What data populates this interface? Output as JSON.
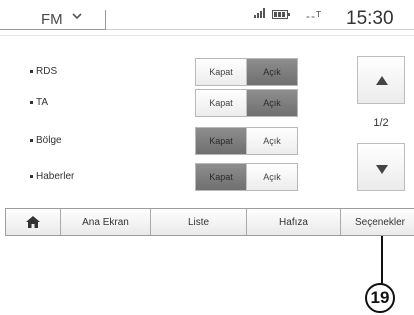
{
  "status_bar": {
    "source": "FM",
    "bt_indicator": "--ᵀ",
    "clock": "15:30",
    "icons": [
      "chevron-down-icon",
      "signal-icon",
      "battery-icon"
    ]
  },
  "settings": [
    {
      "label": "RDS",
      "off_label": "Kapat",
      "on_label": "Açık",
      "state": "on"
    },
    {
      "label": "TA",
      "off_label": "Kapat",
      "on_label": "Açık",
      "state": "on"
    },
    {
      "label": "Bölge",
      "off_label": "Kapat",
      "on_label": "Açık",
      "state": "off"
    },
    {
      "label": "Haberler",
      "off_label": "Kapat",
      "on_label": "Açık",
      "state": "off"
    }
  ],
  "scroll": {
    "page_indicator": "1/2",
    "up_icon": "arrow-up-icon",
    "down_icon": "arrow-down-icon"
  },
  "menu": {
    "home_icon": "home-icon",
    "items": [
      "Ana Ekran",
      "Liste",
      "Hafıza",
      "Seçenekler"
    ]
  },
  "callout": {
    "number": "19"
  },
  "colors": {
    "active_segment": "#7e7e7e",
    "inactive_segment": "#f4f4f4",
    "text": "#333333"
  }
}
